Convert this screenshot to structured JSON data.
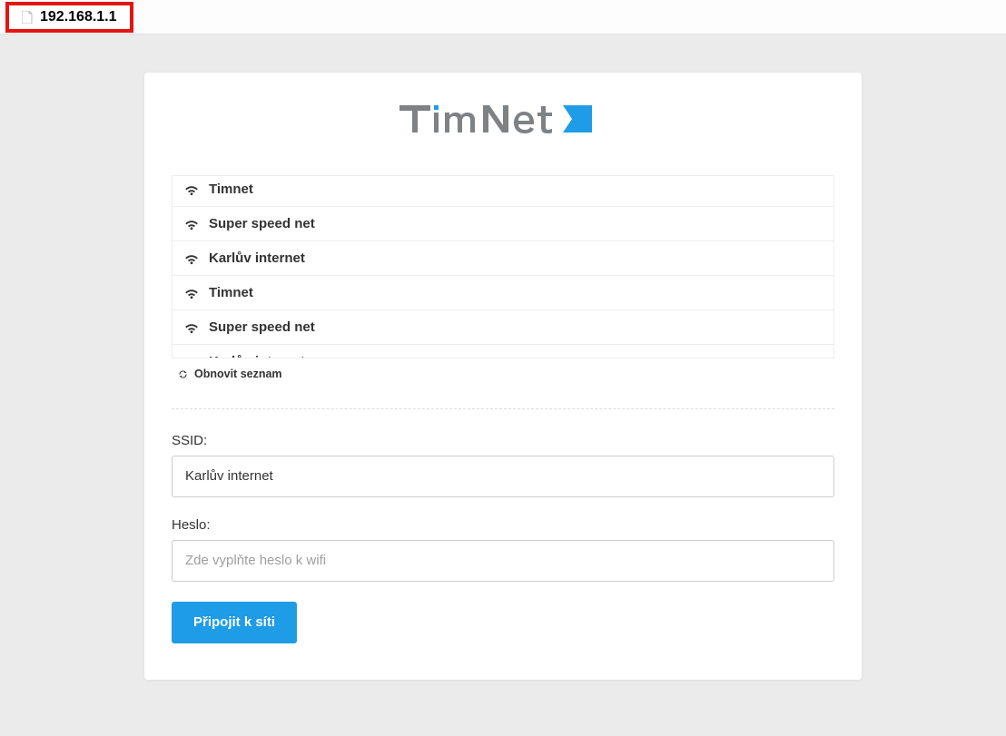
{
  "address_bar": {
    "url": "192.168.1.1"
  },
  "logo": {
    "text": "TimNet",
    "accent": "#1e9ce6",
    "gray": "#7e8285"
  },
  "networks": [
    {
      "ssid": "Timnet"
    },
    {
      "ssid": "Super speed net"
    },
    {
      "ssid": "Karlův internet"
    },
    {
      "ssid": "Timnet"
    },
    {
      "ssid": "Super speed net"
    },
    {
      "ssid": "Karlův internet"
    }
  ],
  "refresh": {
    "label": "Obnovit seznam"
  },
  "form": {
    "ssid_label": "SSID:",
    "ssid_value": "Karlův internet",
    "password_label": "Heslo:",
    "password_placeholder": "Zde vyplňte heslo k wifi",
    "submit_label": "Připojit k síti"
  }
}
